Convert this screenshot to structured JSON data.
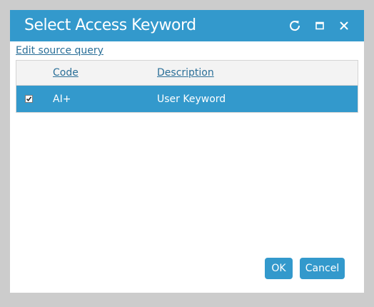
{
  "dialog": {
    "title": "Select Access Keyword",
    "titlebar_icons": [
      "refresh-icon",
      "maximize-icon",
      "close-icon"
    ],
    "accent_color": "#3399cc"
  },
  "edit_source_query_label": "Edit source query",
  "grid": {
    "columns": [
      "Code",
      "Description"
    ],
    "rows": [
      {
        "checked": true,
        "code": "AI+",
        "description": "User Keyword",
        "selected": true
      }
    ]
  },
  "buttons": {
    "ok_label": "OK",
    "cancel_label": "Cancel"
  }
}
